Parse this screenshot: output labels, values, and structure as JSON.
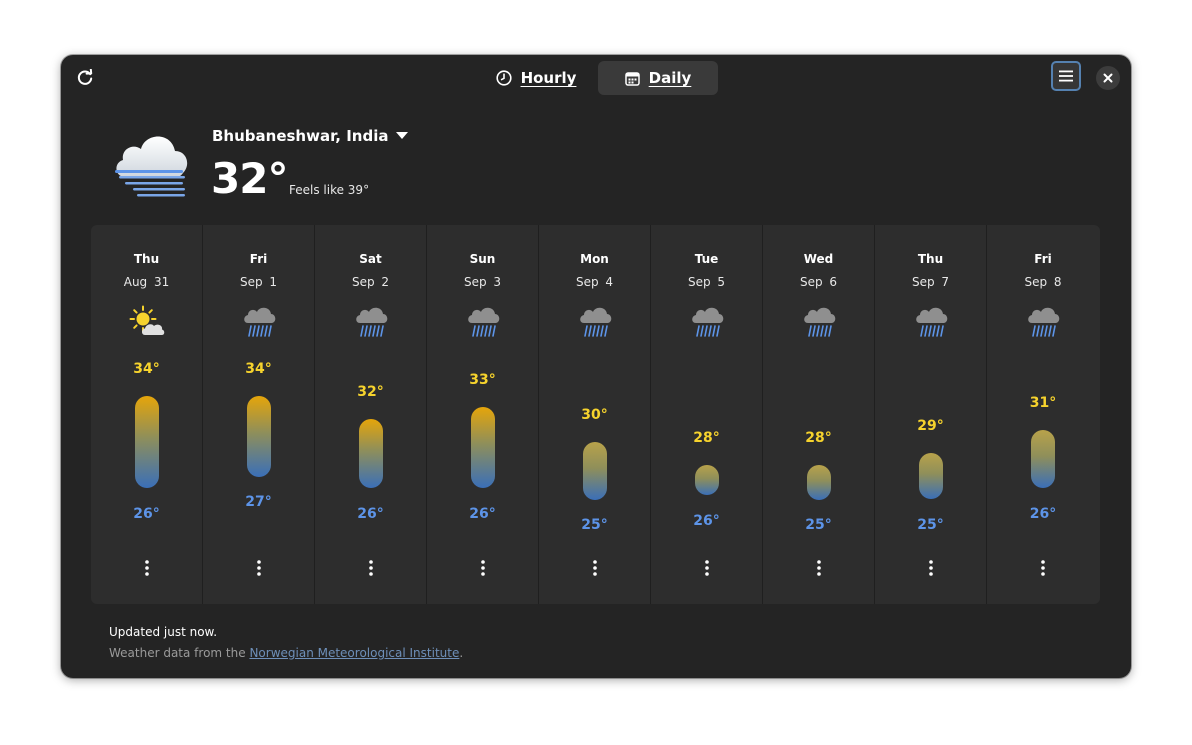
{
  "header": {
    "tabs": [
      {
        "label": "Hourly",
        "icon": "clock-icon"
      },
      {
        "label": "Daily",
        "icon": "calendar-icon",
        "active": true
      }
    ]
  },
  "current": {
    "location": "Bhubaneshwar, India",
    "temperature": "32°",
    "feels_like": "Feels like 39°",
    "icon": "fog-cloud-icon"
  },
  "days": [
    {
      "name": "Thu",
      "date": "Aug 31",
      "icon": "partly-cloudy-icon",
      "high": "34°",
      "low": "26°",
      "high_value": 34,
      "low_value": 26
    },
    {
      "name": "Fri",
      "date": "Sep 1",
      "icon": "rain-icon",
      "high": "34°",
      "low": "27°",
      "high_value": 34,
      "low_value": 27
    },
    {
      "name": "Sat",
      "date": "Sep 2",
      "icon": "rain-icon",
      "high": "32°",
      "low": "26°",
      "high_value": 32,
      "low_value": 26
    },
    {
      "name": "Sun",
      "date": "Sep 3",
      "icon": "rain-icon",
      "high": "33°",
      "low": "26°",
      "high_value": 33,
      "low_value": 26
    },
    {
      "name": "Mon",
      "date": "Sep 4",
      "icon": "rain-icon",
      "high": "30°",
      "low": "25°",
      "high_value": 30,
      "low_value": 25
    },
    {
      "name": "Tue",
      "date": "Sep 5",
      "icon": "rain-icon",
      "high": "28°",
      "low": "26°",
      "high_value": 28,
      "low_value": 26
    },
    {
      "name": "Wed",
      "date": "Sep 6",
      "icon": "rain-icon",
      "high": "28°",
      "low": "25°",
      "high_value": 28,
      "low_value": 25
    },
    {
      "name": "Thu",
      "date": "Sep 7",
      "icon": "rain-icon",
      "high": "29°",
      "low": "25°",
      "high_value": 29,
      "low_value": 25
    },
    {
      "name": "Fri",
      "date": "Sep 8",
      "icon": "rain-icon",
      "high": "31°",
      "low": "26°",
      "high_value": 31,
      "low_value": 26
    }
  ],
  "footer": {
    "updated": "Updated just now.",
    "source_prefix": "Weather data from the ",
    "source_link": "Norwegian Meteorological Institute",
    "source_suffix": "."
  },
  "colors": {
    "high_temp": "#f6d32d",
    "low_temp": "#5d94e8",
    "accent": "#5581b0"
  }
}
